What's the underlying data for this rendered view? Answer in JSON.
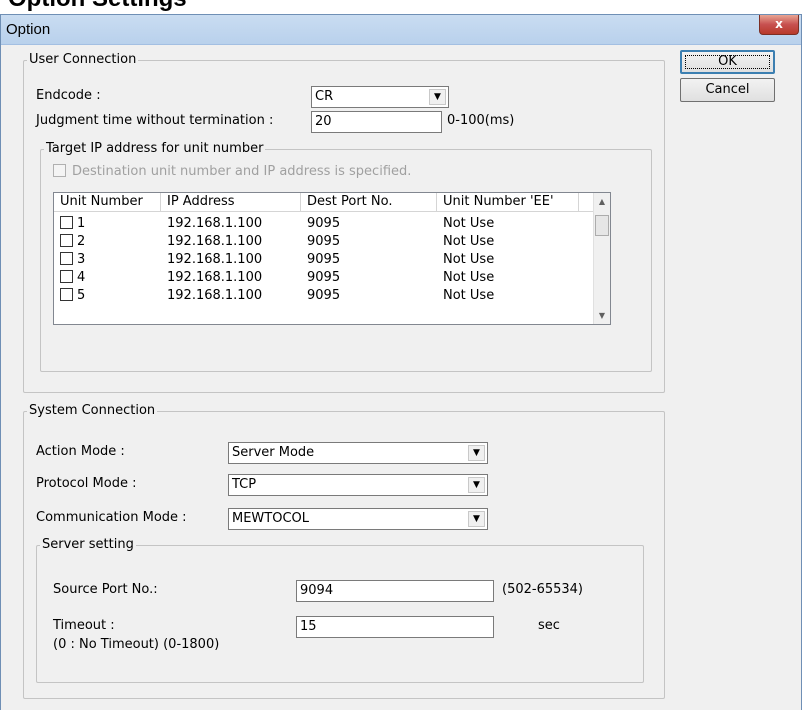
{
  "page_heading": "Option Settings",
  "window": {
    "title": "Option",
    "close_glyph": "x"
  },
  "buttons": {
    "ok": "OK",
    "cancel": "Cancel"
  },
  "user_connection": {
    "legend": "User Connection",
    "endcode_label": "Endcode :",
    "endcode_value": "CR",
    "judgment_label": "Judgment time without termination :",
    "judgment_value": "20",
    "judgment_range": "0-100(ms)",
    "target_ip": {
      "legend": "Target IP address for unit number",
      "dest_checkbox_label": "Destination unit number and IP address is specified.",
      "columns": [
        "Unit Number",
        "IP Address",
        "Dest Port No.",
        "Unit Number 'EE'"
      ],
      "rows": [
        {
          "unit": "1",
          "ip": "192.168.1.100",
          "port": "9095",
          "ee": "Not Use"
        },
        {
          "unit": "2",
          "ip": "192.168.1.100",
          "port": "9095",
          "ee": "Not Use"
        },
        {
          "unit": "3",
          "ip": "192.168.1.100",
          "port": "9095",
          "ee": "Not Use"
        },
        {
          "unit": "4",
          "ip": "192.168.1.100",
          "port": "9095",
          "ee": "Not Use"
        },
        {
          "unit": "5",
          "ip": "192.168.1.100",
          "port": "9095",
          "ee": "Not Use"
        }
      ]
    }
  },
  "system_connection": {
    "legend": "System Connection",
    "action_mode_label": "Action Mode :",
    "action_mode_value": "Server Mode",
    "protocol_mode_label": "Protocol Mode :",
    "protocol_mode_value": "TCP",
    "comm_mode_label": "Communication Mode :",
    "comm_mode_value": "MEWTOCOL",
    "server_setting": {
      "legend": "Server setting",
      "source_port_label": "Source Port No.:",
      "source_port_value": "9094",
      "source_port_range": "(502-65534)",
      "timeout_label": "Timeout :",
      "timeout_sublabel": "(0 : No Timeout)  (0-1800)",
      "timeout_value": "15",
      "timeout_unit": "sec"
    }
  }
}
